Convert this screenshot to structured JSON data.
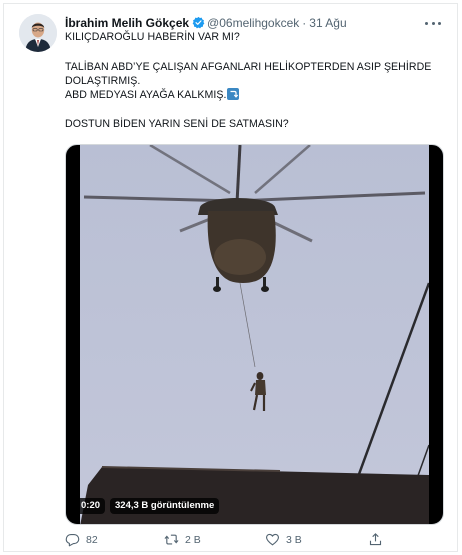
{
  "tweet": {
    "author_name": "İbrahim Melih Gökçek",
    "handle": "@06melihgokcek",
    "separator": "·",
    "date": "31 Ağu",
    "lines": [
      "KILIÇDAROĞLU HABERİN VAR MI?",
      "TALİBAN ABD’YE ÇALIŞAN AFGANLARI HELİKOPTERDEN ASIP ŞEHİRDE",
      "DOLAŞTIRMIŞ.",
      "ABD MEDYASI AYAĞA KALKMIŞ.",
      "DOSTUN BİDEN YARIN SENİ DE SATMASIN?"
    ]
  },
  "media": {
    "duration": "0:20",
    "views": "324,3 B görüntülenme"
  },
  "actions": {
    "replies": "82",
    "retweets": "2 B",
    "likes": "3 B"
  },
  "icons": {
    "verified": "verified-badge-icon",
    "more": "more-icon",
    "reply": "reply-icon",
    "retweet": "retweet-icon",
    "like": "heart-icon",
    "share": "share-icon",
    "emoji": "arrow-right-hook-emoji"
  },
  "colors": {
    "verified": "#1d9bf0",
    "secondary_text": "#536471"
  }
}
